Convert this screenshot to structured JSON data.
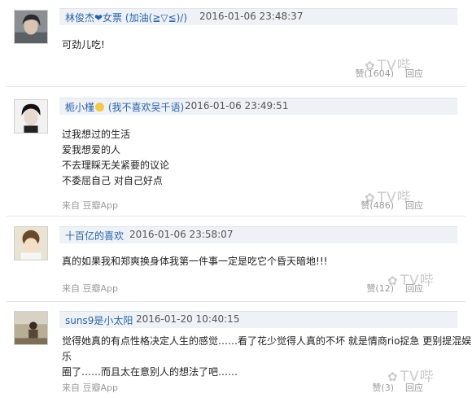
{
  "comments": [
    {
      "user": "林俊杰❤女票",
      "status": "(加油(≧▽≦)/)",
      "time": "2016-01-06 23:48:37",
      "text": "可劲儿吃!",
      "source": "",
      "up": "赞(1604)",
      "reply": "回应"
    },
    {
      "user": "栀小槿",
      "status": "(我不喜欢吴千语)",
      "time": "2016-01-06 23:49:51",
      "text": "过我想过的生活\n爱我想爱的人\n不去理睬无关紧要的议论\n不委屈自己 对自己好点",
      "source": "来自 豆瓣App",
      "up": "赞(486)",
      "reply": "回应"
    },
    {
      "user": "十百亿的喜欢",
      "status": "",
      "time": "2016-01-06 23:58:07",
      "text": "真的如果我和郑爽换身体我第一件事一定是吃它个昏天暗地!!!",
      "source": "来自 豆瓣App",
      "up": "赞(12)",
      "reply": "回应"
    },
    {
      "user": "suns9是小太阳",
      "status": "",
      "time": "2016-01-20 10:40:15",
      "text": "觉得她真的有点性格决定人生的感觉……看了花少觉得人真的不坏 就是情商rio捉急 更别提混娱乐\n圈了……而且太在意别人的想法了吧……",
      "source": "来自 豆瓣App",
      "up": "赞(3)",
      "reply": "回应"
    }
  ],
  "watermark": "TV哔",
  "colors": {
    "link": "#2a63a8",
    "bar": "#eef1f6",
    "meta": "#9a9a9a"
  }
}
